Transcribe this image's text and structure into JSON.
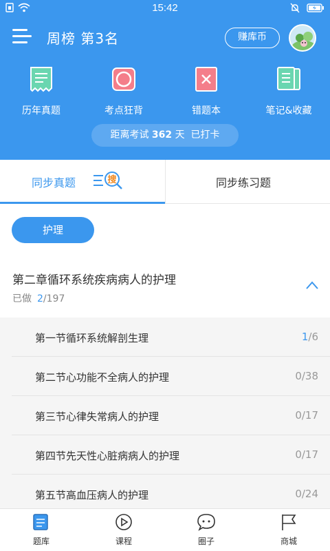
{
  "status_bar": {
    "time": "15:42"
  },
  "header": {
    "title": "周榜 第3名",
    "coin_button": "赚库币",
    "shortcuts": [
      {
        "label": "历年真题",
        "icon": "past-exam-icon"
      },
      {
        "label": "考点狂背",
        "icon": "key-points-icon"
      },
      {
        "label": "错题本",
        "icon": "wrong-questions-icon"
      },
      {
        "label": "笔记&收藏",
        "icon": "notes-favorites-icon"
      }
    ],
    "exam_countdown": {
      "prefix": "距离考试",
      "days": "362",
      "unit": "天",
      "checkin": "已打卡"
    }
  },
  "tabs": {
    "left": "同步真题",
    "search_badge": "搜",
    "right": "同步练习题"
  },
  "subject_button": "护理",
  "chapter": {
    "title": "第二章循环系统疾病病人的护理",
    "progress_label": "已做",
    "done": "2",
    "total": "/197"
  },
  "sections": [
    {
      "name": "第一节循环系统解剖生理",
      "done": "1",
      "total": "/6",
      "highlight": true
    },
    {
      "name": "第二节心功能不全病人的护理",
      "done": "0",
      "total": "/38",
      "highlight": false
    },
    {
      "name": "第三节心律失常病人的护理",
      "done": "0",
      "total": "/17",
      "highlight": false
    },
    {
      "name": "第四节先天性心脏病病人的护理",
      "done": "0",
      "total": "/17",
      "highlight": false
    },
    {
      "name": "第五节高血压病人的护理",
      "done": "0",
      "total": "/24",
      "highlight": false
    }
  ],
  "bottom_nav": [
    {
      "label": "题库",
      "icon": "question-bank-icon"
    },
    {
      "label": "课程",
      "icon": "play-course-icon"
    },
    {
      "label": "圈子",
      "icon": "chat-circle-icon"
    },
    {
      "label": "商城",
      "icon": "flag-shop-icon"
    }
  ],
  "colors": {
    "primary": "#3b97ee",
    "accent_orange": "#f08a24",
    "icon_green": "#6ad6b0",
    "icon_red": "#f47e8a"
  }
}
